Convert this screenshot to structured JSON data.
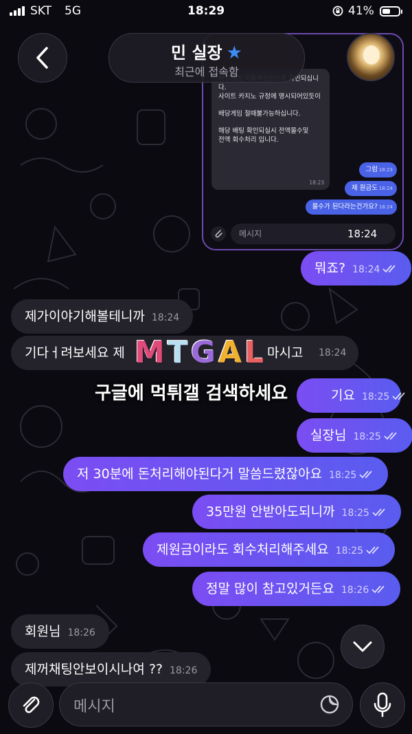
{
  "status_bar": {
    "carrier": "SKT",
    "network": "5G",
    "time": "18:29",
    "battery": "41%"
  },
  "header": {
    "contact_name": "민 실장",
    "last_seen": "최근에 접속함",
    "star_icon": "star-icon",
    "back_icon": "chevron-left-icon"
  },
  "embedded_screenshot": {
    "incoming_lines": [
      "배당게임 이용하신것으로 확인되십니다.",
      "사이트 카지노 규정에 명시되어있듯이",
      "배당게임 절때불가능하십니다.",
      "해당 배팅 확인되실시 전액몰수및",
      "전액 회수처리 입니다."
    ],
    "incoming_time": "18:23",
    "outgoing": [
      {
        "text": "그럼",
        "time": "18:23"
      },
      {
        "text": "제 원금도",
        "time": "18:24"
      },
      {
        "text": "몰수가 된다라는건가요?",
        "time": "18:24"
      }
    ],
    "input_placeholder": "메시지",
    "clock": "18:24"
  },
  "messages": [
    {
      "dir": "out",
      "text": "뭐죠?",
      "time": "18:24"
    },
    {
      "dir": "in",
      "text": "제가이야기해볼테니까",
      "time": "18:24"
    },
    {
      "dir": "in",
      "text": "기다ㅓ려보세요 제",
      "text_tail": "마시고",
      "time": "18:24"
    },
    {
      "dir": "out",
      "text": "기요",
      "time": "18:25"
    },
    {
      "dir": "out",
      "text": "실장님",
      "time": "18:25"
    },
    {
      "dir": "out",
      "text": "저 30분에 돈처리해야된다거 말씀드렸잖아요",
      "time": "18:25"
    },
    {
      "dir": "out",
      "text": "35만원 안받아도되니까",
      "time": "18:25"
    },
    {
      "dir": "out",
      "text": "제원금이라도 회수처리해주세요",
      "time": "18:25"
    },
    {
      "dir": "out",
      "text": "정말 많이 참고있거든요",
      "time": "18:26"
    },
    {
      "dir": "in",
      "text": "회원님",
      "time": "18:26"
    },
    {
      "dir": "in",
      "text": "제꺼채팅안보이시나여 ??",
      "time": "18:26"
    }
  ],
  "watermark": {
    "logo": "MTGAL",
    "caption": "구글에 먹튀갤 검색하세요"
  },
  "composer": {
    "placeholder": "메시지",
    "attach_icon": "paperclip-icon",
    "sticker_icon": "sticker-icon",
    "mic_icon": "microphone-icon",
    "scroll_icon": "chevron-down-icon"
  },
  "colors": {
    "outgoing_start": "#7b4df2",
    "outgoing_end": "#5a5cf0",
    "incoming": "#24232b",
    "background": "#0b0a10",
    "accent_star": "#3d8cf5"
  }
}
